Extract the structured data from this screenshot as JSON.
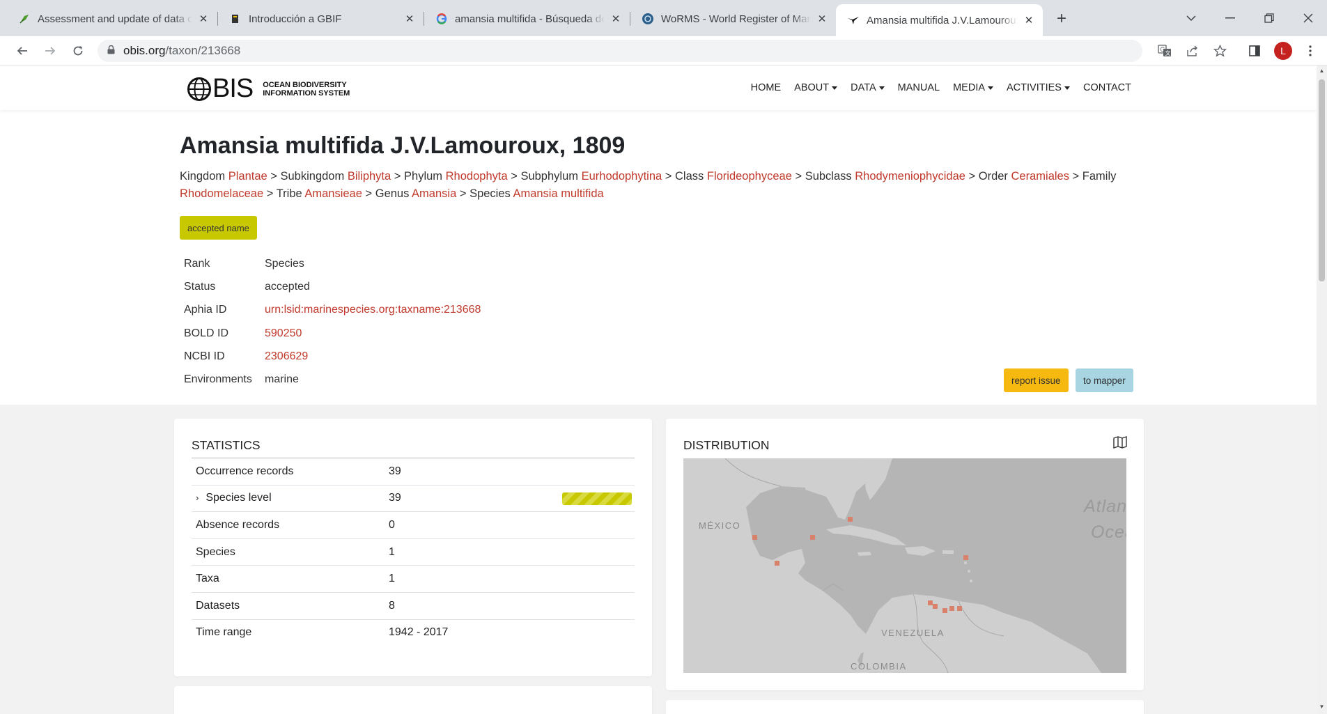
{
  "browser": {
    "tabs": [
      {
        "title": "Assessment and update of data c",
        "icon": "gbif-leaf-icon",
        "left": 0
      },
      {
        "title": "Introducción a GBIF",
        "icon": "gbif-course-icon"
      },
      {
        "title": "amansia multifida - Búsqueda de",
        "icon": "google-icon"
      },
      {
        "title": "WoRMS - World Register of Mari",
        "icon": "worms-icon"
      },
      {
        "title": "Amansia multifida J.V.Lamouroux",
        "icon": "obis-bird-icon"
      }
    ],
    "url_host": "obis.org",
    "url_path": "/taxon/213668",
    "avatar_letter": "L"
  },
  "site": {
    "logo_word": "BIS",
    "logo_sub_line1": "OCEAN BIODIVERSITY",
    "logo_sub_line2": "INFORMATION SYSTEM",
    "nav": [
      "HOME",
      "ABOUT",
      "DATA",
      "MANUAL",
      "MEDIA",
      "ACTIVITIES",
      "CONTACT"
    ]
  },
  "taxon": {
    "title": "Amansia multifida J.V.Lamouroux, 1809",
    "breadcrumb": [
      {
        "rank": "Kingdom",
        "name": "Plantae"
      },
      {
        "rank": "Subkingdom",
        "name": "Biliphyta"
      },
      {
        "rank": "Phylum",
        "name": "Rhodophyta"
      },
      {
        "rank": "Subphylum",
        "name": "Eurhodophytina"
      },
      {
        "rank": "Class",
        "name": "Florideophyceae"
      },
      {
        "rank": "Subclass",
        "name": "Rhodymeniophycidae"
      },
      {
        "rank": "Order",
        "name": "Ceramiales"
      },
      {
        "rank": "Family",
        "name": "Rhodomelaceae"
      },
      {
        "rank": "Tribe",
        "name": "Amansieae"
      },
      {
        "rank": "Genus",
        "name": "Amansia"
      },
      {
        "rank": "Species",
        "name": "Amansia multifida"
      }
    ],
    "badge": "accepted name",
    "properties": [
      {
        "key": "Rank",
        "value": "Species",
        "link": false
      },
      {
        "key": "Status",
        "value": "accepted",
        "link": false
      },
      {
        "key": "Aphia ID",
        "value": "urn:lsid:marinespecies.org:taxname:213668",
        "link": true
      },
      {
        "key": "BOLD ID",
        "value": "590250",
        "link": true
      },
      {
        "key": "NCBI ID",
        "value": "2306629",
        "link": true
      },
      {
        "key": "Environments",
        "value": "marine",
        "link": false
      }
    ],
    "report_issue": "report issue",
    "to_mapper": "to mapper"
  },
  "statistics": {
    "title": "STATISTICS",
    "rows": [
      {
        "key": "Occurrence records",
        "value": "39"
      },
      {
        "key": "Species level",
        "value": "39",
        "expandable": true,
        "quality_fraction": 1.0
      },
      {
        "key": "Absence records",
        "value": "0"
      },
      {
        "key": "Species",
        "value": "1"
      },
      {
        "key": "Taxa",
        "value": "1"
      },
      {
        "key": "Datasets",
        "value": "8"
      },
      {
        "key": "Time range",
        "value": "1942 - 2017"
      }
    ]
  },
  "distribution": {
    "title": "DISTRIBUTION",
    "labels": [
      "MÉXICO",
      "VENEZUELA",
      "COLOMBIA",
      "Atlan",
      "Ocea"
    ]
  },
  "colors": {
    "link": "#c0392b",
    "accepted_badge": "#c8c800",
    "report_issue": "#f5b90f",
    "to_mapper": "#a9d5e3",
    "occurrence_dot": "#d9826b"
  }
}
